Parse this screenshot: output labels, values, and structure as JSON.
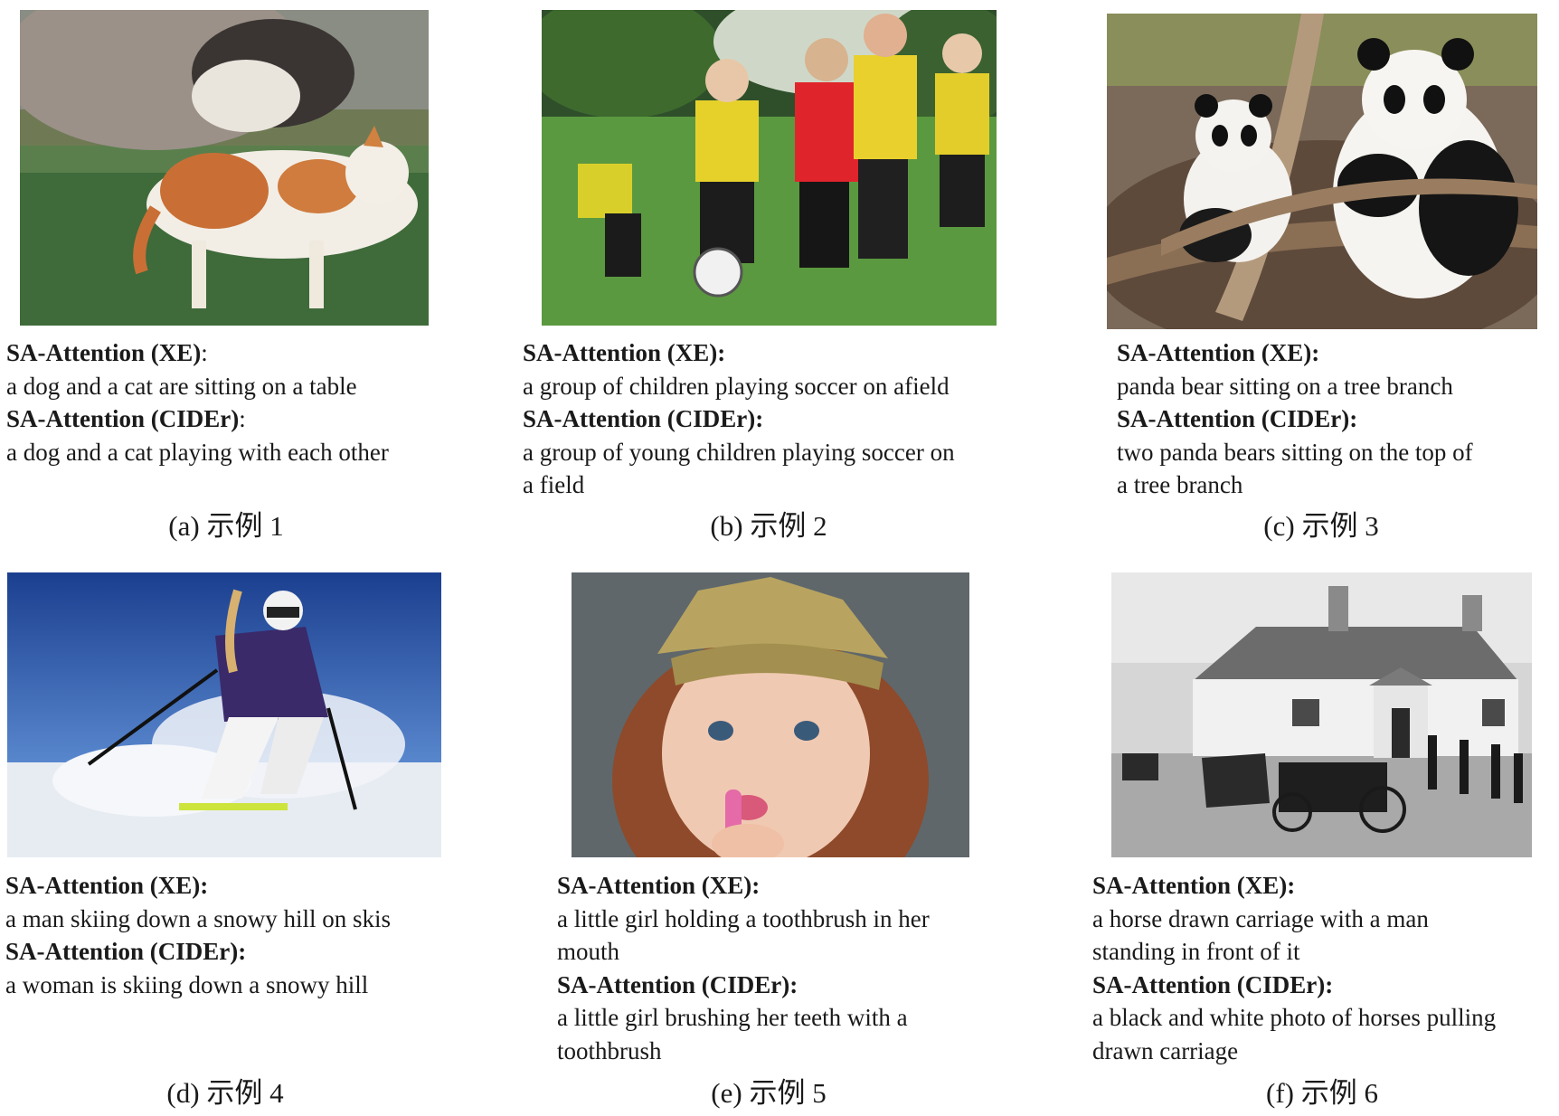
{
  "panels": [
    {
      "xe_label": "SA-Attention (XE)",
      "xe_colon": ":",
      "xe_lines": [
        "a dog and a cat are sitting on a table"
      ],
      "cider_label": "SA-Attention (CIDEr)",
      "cider_colon": ":",
      "cider_lines": [
        "a dog and a cat playing with each other"
      ],
      "subcaption": "(a) 示例 1"
    },
    {
      "xe_label": "SA-Attention (XE):",
      "xe_colon": "",
      "xe_lines": [
        "a group of children playing soccer on afield"
      ],
      "cider_label": "SA-Attention (CIDEr):",
      "cider_colon": "",
      "cider_lines": [
        "a group of young children playing soccer on",
        "a field"
      ],
      "subcaption": "(b) 示例 2"
    },
    {
      "xe_label": "SA-Attention (XE):",
      "xe_colon": "",
      "xe_lines": [
        "panda bear sitting on a tree branch"
      ],
      "cider_label": "SA-Attention (CIDEr):",
      "cider_colon": "",
      "cider_lines": [
        "two panda bears sitting on the top of",
        "a tree branch"
      ],
      "subcaption": "(c) 示例 3"
    },
    {
      "xe_label": "SA-Attention (XE):",
      "xe_colon": "",
      "xe_lines": [
        "a man skiing down a snowy hill on skis"
      ],
      "cider_label": "SA-Attention (CIDEr):",
      "cider_colon": "",
      "cider_lines": [
        "a woman is skiing down a snowy hill"
      ],
      "subcaption": "(d) 示例 4"
    },
    {
      "xe_label": "SA-Attention (XE):",
      "xe_colon": "",
      "xe_lines": [
        "a little girl holding a toothbrush in her",
        "mouth"
      ],
      "cider_label": "SA-Attention (CIDEr):",
      "cider_colon": "",
      "cider_lines": [
        "a little girl brushing her teeth with a",
        "toothbrush"
      ],
      "subcaption": "(e) 示例 5"
    },
    {
      "xe_label": "SA-Attention (XE):",
      "xe_colon": "",
      "xe_lines": [
        "a horse drawn carriage with a man",
        "standing in front of it"
      ],
      "cider_label": "SA-Attention (CIDEr):",
      "cider_colon": "",
      "cider_lines": [
        "a black and white photo of horses pulling",
        "drawn carriage"
      ],
      "subcaption": "(f) 示例 6"
    }
  ]
}
